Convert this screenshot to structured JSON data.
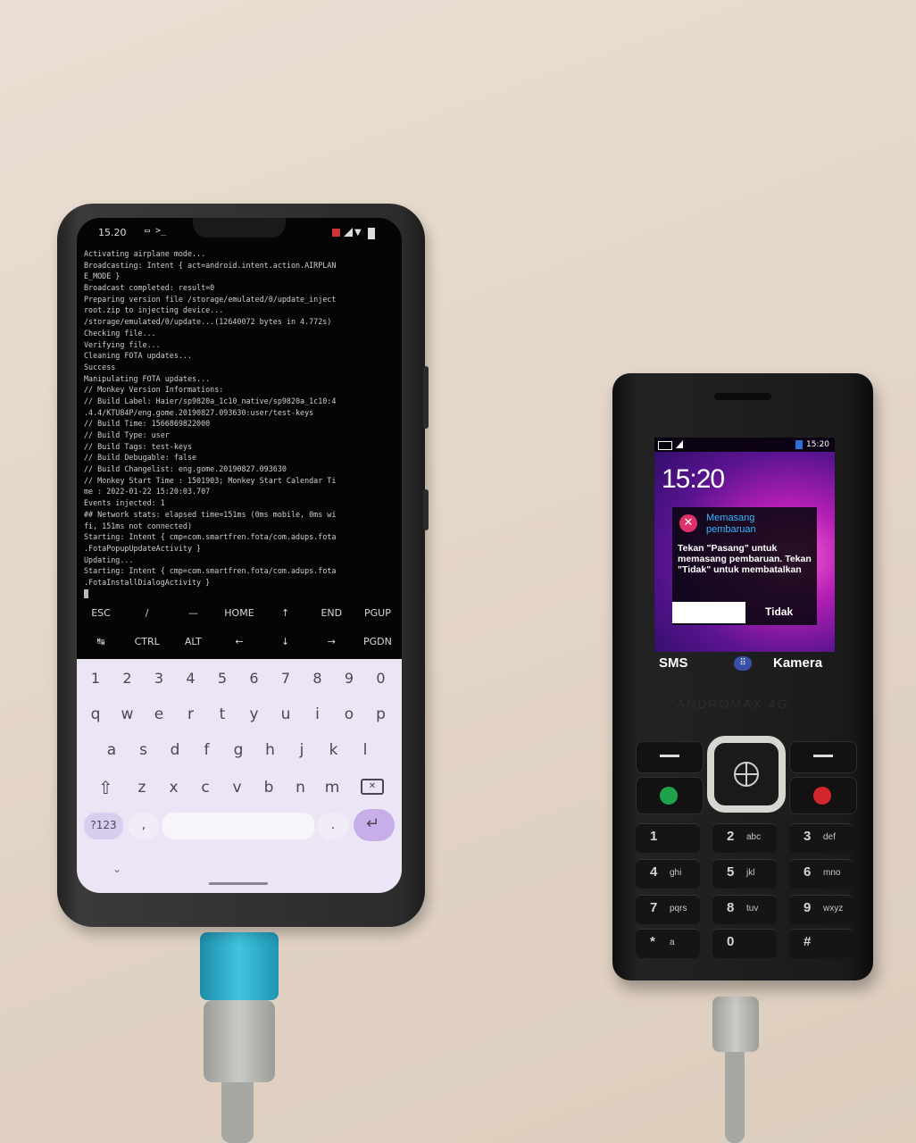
{
  "smartphone": {
    "status_time": "15.20",
    "terminal_lines": [
      "Activating airplane mode...",
      "Broadcasting: Intent { act=android.intent.action.AIRPLAN",
      "E_MODE }",
      "Broadcast completed: result=0",
      "Preparing version file /storage/emulated/0/update_inject",
      "root.zip to injecting device...",
      "/storage/emulated/0/update...(12640072 bytes in 4.772s)",
      "Checking file...",
      "Verifying file...",
      "Cleaning FOTA updates...",
      "Success",
      "Manipulating FOTA updates...",
      "// Monkey Version Informations:",
      "// Build Label: Haier/sp9820a_1c10_native/sp9820a_1c10:4",
      ".4.4/KTU84P/eng.gome.20190827.093630:user/test-keys",
      "// Build Time: 1566869822000",
      "// Build Type: user",
      "// Build Tags: test-keys",
      "// Build Debugable: false",
      "// Build Changelist: eng.gome.20190827.093630",
      "// Monkey Start Time : 1501903; Monkey Start Calendar Ti",
      "me : 2022-01-22 15:20:03.707",
      "Events injected: 1",
      "## Network stats: elapsed time=151ms (0ms mobile, 0ms wi",
      "fi, 151ms not connected)",
      "Starting: Intent { cmp=com.smartfren.fota/com.adups.fota",
      ".FotaPopupUpdateActivity }",
      "Updating...",
      "Starting: Intent { cmp=com.smartfren.fota/com.adups.fota",
      ".FotaInstallDialogActivity }"
    ],
    "extra_keys_row1": [
      "ESC",
      "/",
      "—",
      "HOME",
      "↑",
      "END",
      "PGUP"
    ],
    "extra_keys_row2": [
      "↹",
      "CTRL",
      "ALT",
      "←",
      "↓",
      "→",
      "PGDN"
    ],
    "keyboard": {
      "row_numbers": [
        "1",
        "2",
        "3",
        "4",
        "5",
        "6",
        "7",
        "8",
        "9",
        "0"
      ],
      "row_1": [
        "q",
        "w",
        "e",
        "r",
        "t",
        "y",
        "u",
        "i",
        "o",
        "p"
      ],
      "row_2": [
        "a",
        "s",
        "d",
        "f",
        "g",
        "h",
        "j",
        "k",
        "l"
      ],
      "row_3": [
        "z",
        "x",
        "c",
        "v",
        "b",
        "n",
        "m"
      ],
      "symbols_key": "?123",
      "comma_key": ",",
      "period_key": "."
    }
  },
  "feature_phone": {
    "status_time": "15:20",
    "clock": "15:20",
    "dialog_title": "Memasang pembaruan",
    "dialog_body": "Tekan \"Pasang\" untuk memasang pembaruan. Tekan \"Tidak\" untuk membatalkan",
    "dialog_cancel": "Tidak",
    "softkey_left": "SMS",
    "softkey_right": "Kamera",
    "brand": "ANDROMAX 4G",
    "keypad": [
      {
        "digit": "1",
        "letters": ""
      },
      {
        "digit": "2",
        "letters": "abc"
      },
      {
        "digit": "3",
        "letters": "def"
      },
      {
        "digit": "4",
        "letters": "ghi"
      },
      {
        "digit": "5",
        "letters": "jkl"
      },
      {
        "digit": "6",
        "letters": "mno"
      },
      {
        "digit": "7",
        "letters": "pqrs"
      },
      {
        "digit": "8",
        "letters": "tuv"
      },
      {
        "digit": "9",
        "letters": "wxyz"
      },
      {
        "digit": "*",
        "letters": "a"
      },
      {
        "digit": "0",
        "letters": ""
      },
      {
        "digit": "#",
        "letters": ""
      }
    ]
  },
  "colors": {
    "keyboard_bg": "#ece5f6",
    "enter_key": "#c7aee9",
    "screen_magenta": "#b51fb4"
  }
}
